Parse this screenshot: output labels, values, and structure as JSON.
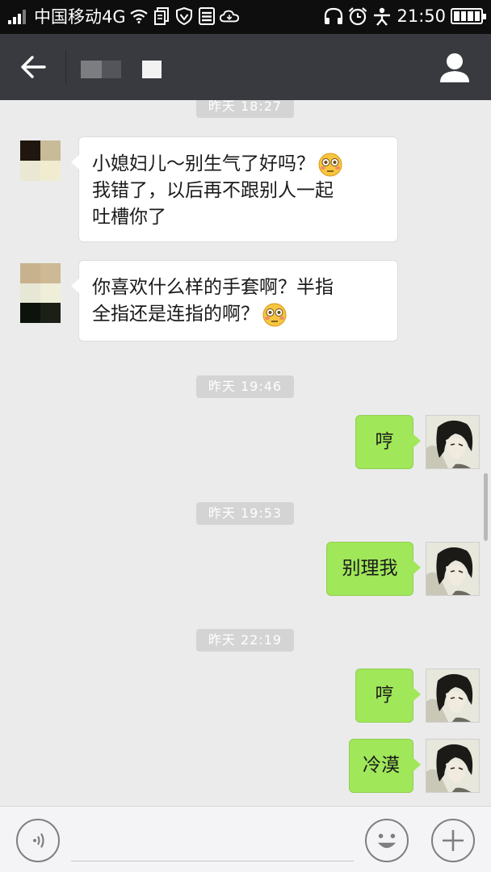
{
  "status_bar": {
    "carrier": "中国移动4G",
    "time": "21:50",
    "icons": [
      "signal-icon",
      "wifi-icon",
      "document-icon",
      "shield-icon",
      "list-icon",
      "cloud-icon",
      "headphones-icon",
      "alarm-icon",
      "person-icon",
      "battery-icon"
    ]
  },
  "header": {
    "back_icon": "back-arrow-icon",
    "profile_icon": "user-icon"
  },
  "chat": {
    "messages": [
      {
        "time": "昨天 18:27"
      },
      {
        "side": "incoming",
        "lines": [
          "小媳妇儿～别生气了好吗？",
          "我错了，以后再不跟别人一起",
          "吐槽你了"
        ],
        "emoji": "flushed-face"
      },
      {
        "side": "incoming",
        "lines": [
          "你喜欢什么样的手套啊？半指",
          "全指还是连指的啊？"
        ],
        "emoji": "flushed-face"
      },
      {
        "time": "昨天 19:46"
      },
      {
        "side": "outgoing",
        "text": "哼"
      },
      {
        "time": "昨天 19:53"
      },
      {
        "side": "outgoing",
        "text": "别理我"
      },
      {
        "time": "昨天 22:19"
      },
      {
        "side": "outgoing",
        "text": "哼"
      },
      {
        "side": "outgoing",
        "text": "冷漠"
      }
    ]
  },
  "input_bar": {
    "voice_icon": "voice-icon",
    "emoji_icon": "emoji-icon",
    "plus_icon": "plus-icon"
  },
  "colors": {
    "status_bar": "#0e0e0e",
    "header": "#393a3f",
    "chat_background": "#ebebeb",
    "incoming_bubble": "#ffffff",
    "outgoing_bubble": "#a0e759",
    "timestamp_pill": "#d4d4d4"
  }
}
